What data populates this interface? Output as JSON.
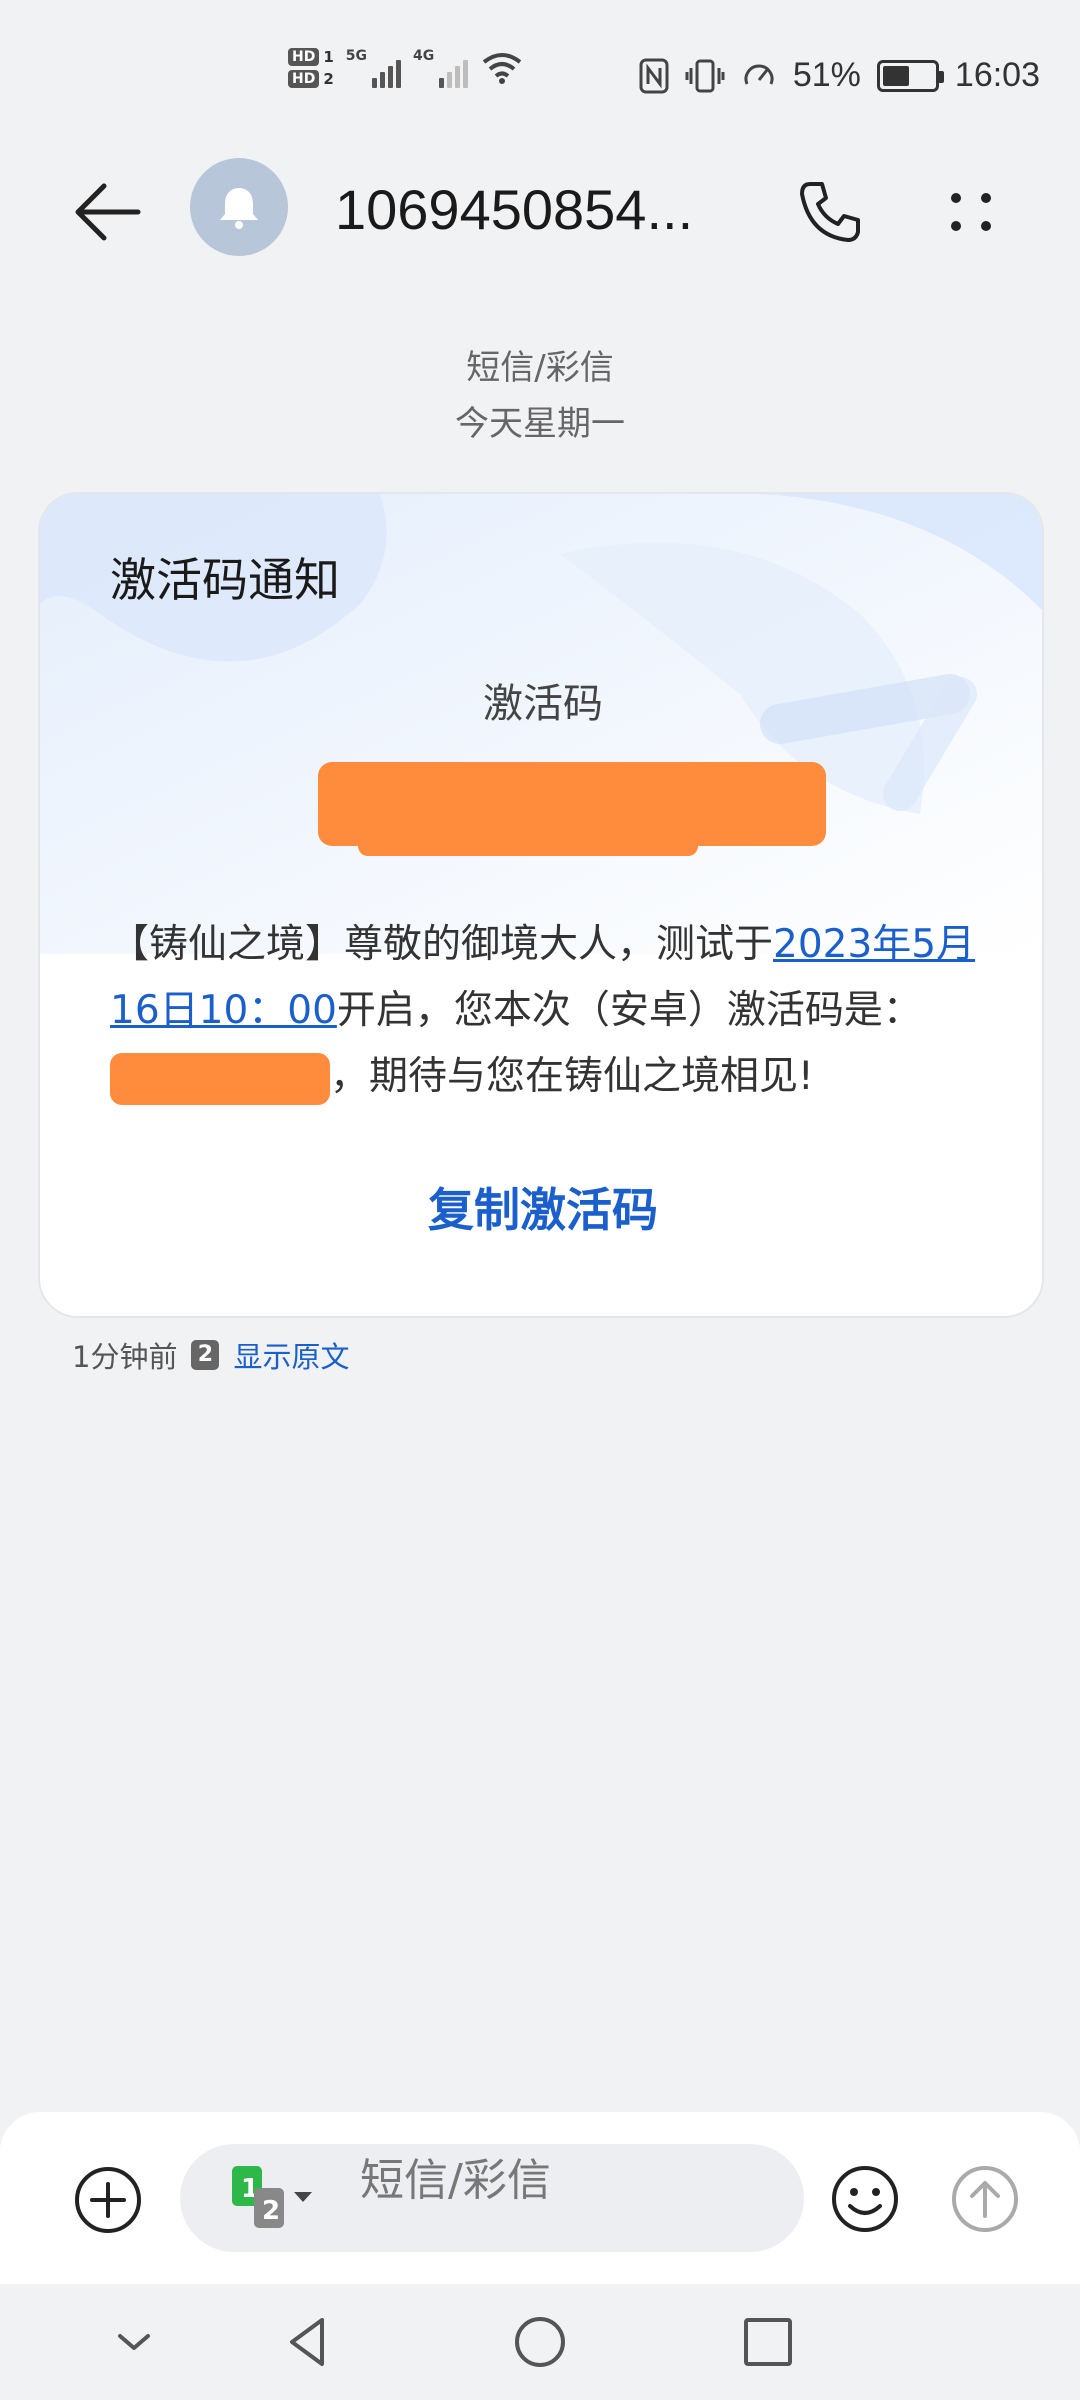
{
  "status_bar": {
    "hd1": "HD",
    "sim1": "1",
    "hd2": "HD",
    "sim2": "2",
    "net1": "5G",
    "net2": "4G",
    "battery_percent": "51%",
    "battery_level": 0.51,
    "time": "16:03",
    "icons": [
      "nfc-icon",
      "vibrate-icon",
      "speed-icon",
      "wifi-icon",
      "battery-icon"
    ]
  },
  "header": {
    "title": "1069450854...",
    "icons": [
      "back-arrow-icon",
      "bell-icon",
      "phone-icon",
      "more-icon"
    ]
  },
  "date_separator": {
    "type": "短信/彩信",
    "day": "今天星期一"
  },
  "card": {
    "title": "激活码通知",
    "code_label": "激活码",
    "body": {
      "part1": "【铸仙之境】尊敬的御境大人，测试于",
      "link": "2023年5月16日10：00",
      "part2": "开启，您本次（安卓）激活码是：",
      "part3": "，期待与您在铸仙之境相见!"
    },
    "copy_label": "复制激活码"
  },
  "meta": {
    "time": "1分钟前",
    "sim": "2",
    "show_original": "显示原文"
  },
  "input": {
    "placeholder": "短信/彩信",
    "sim_active": "1",
    "sim_other": "2"
  },
  "colors": {
    "accent": "#1a5fcc",
    "redaction": "#ff8c3d",
    "background": "#f1f2f4",
    "avatar": "#b7c6d9"
  }
}
